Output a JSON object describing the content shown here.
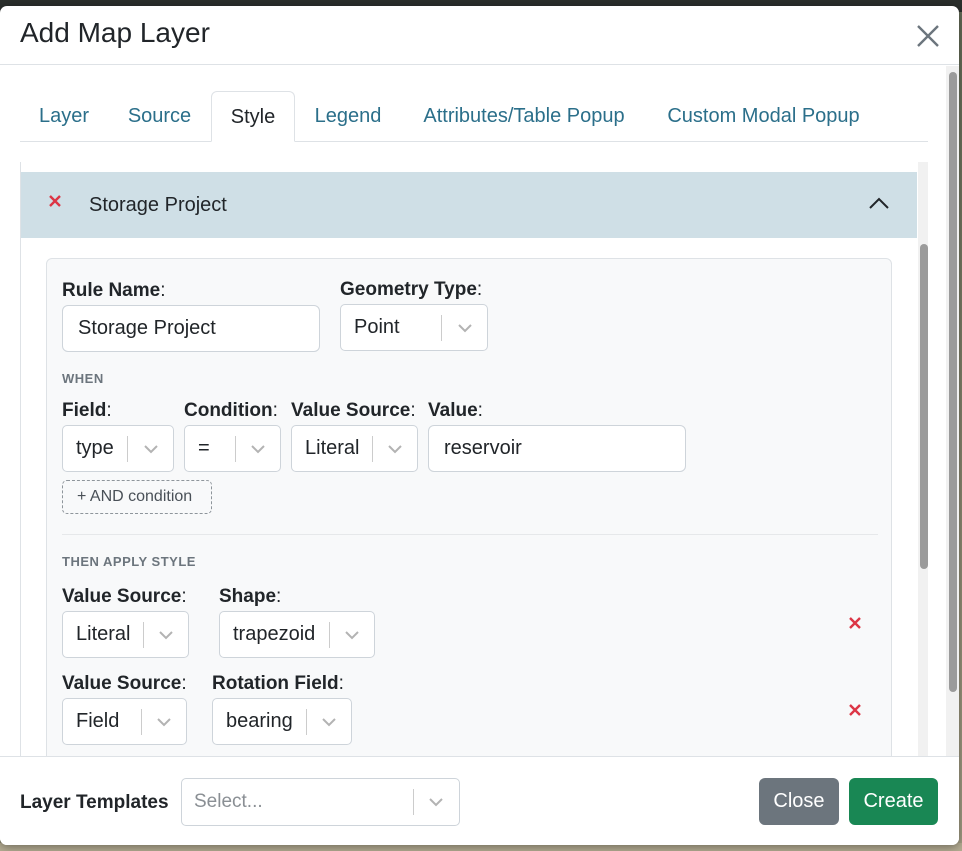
{
  "modal": {
    "title": "Add Map Layer"
  },
  "tabs": [
    {
      "label": "Layer",
      "active": false
    },
    {
      "label": "Source",
      "active": false
    },
    {
      "label": "Style",
      "active": true
    },
    {
      "label": "Legend",
      "active": false
    },
    {
      "label": "Attributes/Table Popup",
      "active": false
    },
    {
      "label": "Custom Modal Popup",
      "active": false
    }
  ],
  "rule": {
    "header_title": "Storage Project",
    "rule_name_label": "Rule Name",
    "rule_name_value": "Storage Project",
    "geometry_type_label": "Geometry Type",
    "geometry_type_value": "Point",
    "when_heading": "WHEN",
    "condition": {
      "field_label": "Field",
      "field_value": "type",
      "condition_label": "Condition",
      "condition_value": "=",
      "value_source_label": "Value Source",
      "value_source_value": "Literal",
      "value_label": "Value",
      "value_value": "reservoir"
    },
    "add_condition_label": "+ AND condition",
    "then_heading": "THEN APPLY STYLE",
    "styles": [
      {
        "value_source_label": "Value Source",
        "value_source_value": "Literal",
        "prop_label": "Shape",
        "prop_value": "trapezoid"
      },
      {
        "value_source_label": "Value Source",
        "value_source_value": "Field",
        "prop_label": "Rotation Field",
        "prop_value": "bearing"
      }
    ]
  },
  "footer": {
    "templates_label": "Layer Templates",
    "templates_placeholder": "Select...",
    "close_label": "Close",
    "create_label": "Create"
  },
  "colors": {
    "accent_link": "#2b6f8a",
    "accordion_header": "#cfdfe6",
    "danger": "#dc3545",
    "close_button": "#6c757d",
    "create_button": "#198754"
  },
  "icons": {
    "modal_close": "close-icon",
    "remove": "remove-x-icon",
    "collapse": "chevron-up-icon",
    "select_dropdown": "chevron-down-icon"
  }
}
